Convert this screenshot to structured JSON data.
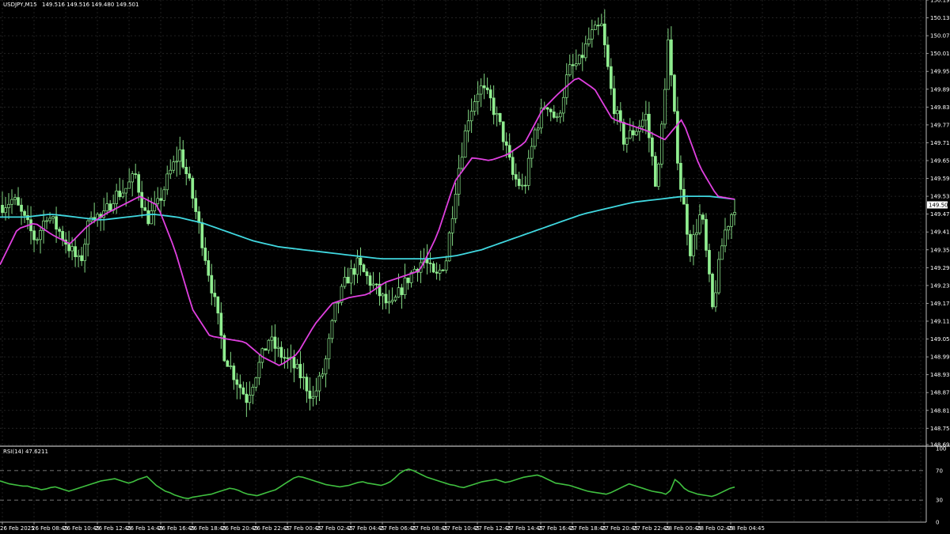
{
  "header": {
    "symbol": "USDJPY,M15",
    "ohlc": "149.516 149.516 149.480 149.501"
  },
  "rsi_header": {
    "label": "RSI(14) 47.6211"
  },
  "colors": {
    "background": "#000000",
    "grid": "#2a2a2a",
    "candle": "#90ee90",
    "ma_fast": "#e040e0",
    "ma_slow": "#40d8e0",
    "rsi": "#40c040",
    "current_price_bg": "#ffffff"
  },
  "current_price": "149.501",
  "chart_data": [
    {
      "type": "candlestick",
      "symbol": "USDJPY",
      "timeframe": "M15",
      "ylim": [
        148.695,
        150.19
      ],
      "price_ticks": [
        "150.190",
        "150.130",
        "150.070",
        "150.010",
        "149.950",
        "149.890",
        "149.830",
        "149.770",
        "149.710",
        "149.650",
        "149.590",
        "149.530",
        "149.470",
        "149.410",
        "149.350",
        "149.290",
        "149.230",
        "149.170",
        "149.110",
        "149.050",
        "148.990",
        "148.930",
        "148.870",
        "148.810",
        "148.750",
        "148.695"
      ],
      "time_ticks": [
        "26 Feb 2025",
        "26 Feb 08:45",
        "26 Feb 10:45",
        "26 Feb 12:45",
        "26 Feb 14:45",
        "26 Feb 16:45",
        "26 Feb 18:45",
        "26 Feb 20:45",
        "26 Feb 22:45",
        "27 Feb 00:45",
        "27 Feb 02:45",
        "27 Feb 04:45",
        "27 Feb 06:45",
        "27 Feb 08:45",
        "27 Feb 10:45",
        "27 Feb 12:45",
        "27 Feb 14:45",
        "27 Feb 16:45",
        "27 Feb 18:45",
        "27 Feb 20:45",
        "27 Feb 22:45",
        "28 Feb 00:45",
        "28 Feb 02:45",
        "28 Feb 04:45"
      ],
      "close_anchors": [
        149.5,
        149.52,
        149.45,
        149.38,
        149.47,
        149.42,
        149.36,
        149.3,
        149.48,
        149.45,
        149.53,
        149.55,
        149.6,
        149.45,
        149.5,
        149.6,
        149.68,
        149.55,
        149.38,
        149.2,
        149.0,
        148.92,
        148.85,
        148.95,
        149.05,
        149.0,
        148.97,
        148.92,
        148.85,
        148.95,
        149.15,
        149.25,
        149.3,
        149.25,
        149.2,
        149.15,
        149.22,
        149.28,
        149.32,
        149.25,
        149.32,
        149.6,
        149.8,
        149.9,
        149.85,
        149.75,
        149.6,
        149.55,
        149.75,
        149.85,
        149.78,
        149.95,
        149.98,
        150.07,
        150.1,
        149.85,
        149.72,
        149.75,
        149.8,
        149.55,
        150.05,
        149.6,
        149.35,
        149.48,
        149.15,
        149.4,
        149.5
      ],
      "ma_fast_anchors": [
        149.3,
        149.42,
        149.44,
        149.4,
        149.37,
        149.43,
        149.47,
        149.5,
        149.53,
        149.5,
        149.35,
        149.15,
        149.06,
        149.05,
        149.04,
        148.99,
        148.96,
        149.0,
        149.1,
        149.17,
        149.19,
        149.2,
        149.24,
        149.26,
        149.28,
        149.4,
        149.58,
        149.66,
        149.65,
        149.67,
        149.71,
        149.82,
        149.88,
        149.93,
        149.89,
        149.79,
        149.77,
        149.75,
        149.72,
        149.79,
        149.63,
        149.53,
        149.52
      ],
      "ma_slow_anchors": [
        149.46,
        149.46,
        149.47,
        149.46,
        149.45,
        149.46,
        149.47,
        149.46,
        149.44,
        149.41,
        149.38,
        149.36,
        149.35,
        149.34,
        149.33,
        149.32,
        149.32,
        149.32,
        149.33,
        149.35,
        149.38,
        149.41,
        149.44,
        149.47,
        149.49,
        149.51,
        149.52,
        149.53,
        149.53,
        149.52
      ]
    },
    {
      "type": "line",
      "name": "RSI(14) 47.6211",
      "ylim": [
        0,
        100
      ],
      "y_ticks": [
        "100",
        "70",
        "30",
        "0"
      ],
      "levels": [
        30,
        70
      ],
      "values": [
        56,
        54,
        52,
        51,
        50,
        49,
        49,
        47,
        46,
        44,
        45,
        47,
        48,
        46,
        44,
        42,
        44,
        46,
        48,
        50,
        52,
        54,
        56,
        57,
        58,
        59,
        57,
        55,
        53,
        55,
        58,
        60,
        62,
        56,
        50,
        46,
        42,
        40,
        37,
        35,
        33,
        32,
        34,
        35,
        36,
        37,
        38,
        40,
        42,
        44,
        46,
        45,
        43,
        40,
        38,
        37,
        36,
        38,
        40,
        42,
        44,
        48,
        52,
        56,
        60,
        62,
        61,
        59,
        57,
        55,
        53,
        51,
        50,
        49,
        48,
        49,
        50,
        52,
        54,
        55,
        53,
        52,
        51,
        50,
        52,
        55,
        60,
        66,
        70,
        72,
        70,
        67,
        64,
        61,
        59,
        57,
        55,
        53,
        51,
        50,
        48,
        47,
        49,
        51,
        53,
        55,
        56,
        57,
        58,
        56,
        54,
        55,
        57,
        59,
        61,
        62,
        63,
        64,
        62,
        59,
        56,
        53,
        52,
        51,
        50,
        48,
        46,
        44,
        42,
        41,
        40,
        39,
        38,
        40,
        43,
        46,
        49,
        52,
        50,
        48,
        46,
        44,
        42,
        41,
        40,
        38,
        43,
        58,
        53,
        46,
        42,
        40,
        38,
        37,
        36,
        35,
        37,
        40,
        43,
        46,
        47.62
      ]
    }
  ]
}
